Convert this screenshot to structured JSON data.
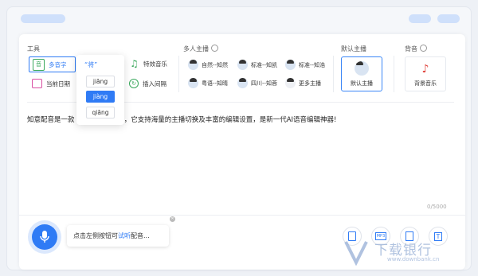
{
  "sections": {
    "tools": "工具",
    "multi_anchor": "多人主播",
    "default_anchor": "默认主播",
    "bgm": "背音"
  },
  "tools": [
    {
      "label": "多音字",
      "icon": "polyphone-icon",
      "active": true
    },
    {
      "label": "当前日期",
      "icon": "calendar-icon"
    },
    {
      "label": "特效音乐",
      "icon": "music-note-icon"
    },
    {
      "label": "插入间隔",
      "icon": "interval-icon"
    }
  ],
  "anchors": [
    "自然--知然",
    "标准--知凯",
    "标准--知浩",
    "粤语--知晴",
    "四川--知蓉",
    "更多主播"
  ],
  "default_anchor": {
    "label": "默认主播"
  },
  "background_music": {
    "label": "背景音乐"
  },
  "popup": {
    "char": "“将”",
    "options": [
      "jiāng",
      "jiàng",
      "qiāng"
    ],
    "selected": 1
  },
  "editor": {
    "text": "知意配音是一款                              文字转语音软件，它支持海量的主播切换及丰富的编辑设置，是新一代AI语音编辑神器!",
    "count": "0/5000"
  },
  "footer": {
    "prompt_before": "点击左侧按钮可",
    "prompt_highlight": "试听",
    "prompt_after": "配音..."
  },
  "watermark": {
    "title": "下载银行",
    "url": "www.downbank.cn"
  },
  "colors": {
    "accent": "#2f7bf5"
  }
}
